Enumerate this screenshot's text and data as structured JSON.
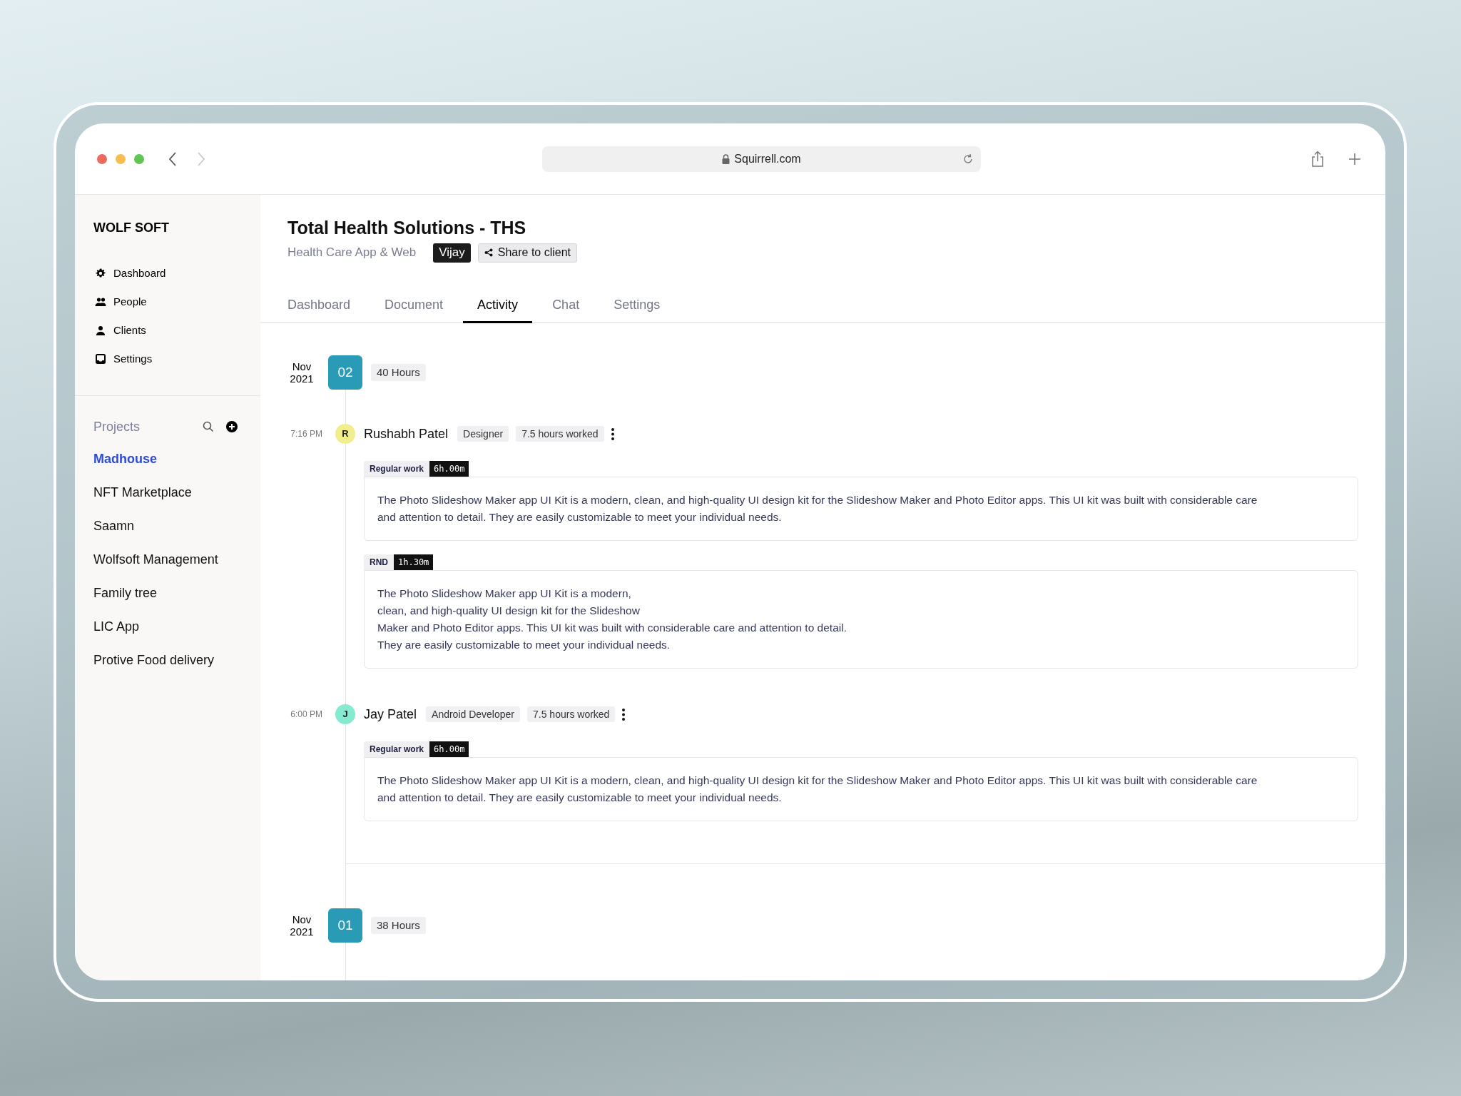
{
  "browser": {
    "url": "Squirrell.com"
  },
  "sidebar": {
    "brand": "WOLF SOFT",
    "nav": [
      {
        "kind": "gear",
        "label": "Dashboard"
      },
      {
        "kind": "people",
        "label": "People"
      },
      {
        "kind": "person",
        "label": "Clients"
      },
      {
        "kind": "tray",
        "label": "Settings"
      }
    ],
    "projects_title": "Projects",
    "projects": [
      {
        "label": "Madhouse",
        "selected": true
      },
      {
        "label": "NFT Marketplace",
        "selected": false
      },
      {
        "label": "Saamn",
        "selected": false
      },
      {
        "label": "Wolfsoft Management",
        "selected": false
      },
      {
        "label": "Family tree",
        "selected": false
      },
      {
        "label": "LIC App",
        "selected": false
      },
      {
        "label": "Protive Food delivery",
        "selected": false
      }
    ]
  },
  "header": {
    "title": "Total Health Solutions - THS",
    "subtitle": "Health Care App & Web",
    "owner": "Vijay",
    "share": "Share to client"
  },
  "tabs": [
    {
      "label": "Dashboard",
      "selected": false
    },
    {
      "label": "Document",
      "selected": false
    },
    {
      "label": "Activity",
      "selected": true
    },
    {
      "label": "Chat",
      "selected": false
    },
    {
      "label": "Settings",
      "selected": false
    }
  ],
  "days": [
    {
      "month": "Nov",
      "year": "2021",
      "day": "02",
      "hours": "40 Hours",
      "entries": [
        {
          "time": "7:16 PM",
          "initial": "R",
          "color": "#f2ee8e",
          "name": "Rushabh Patel",
          "role": "Designer",
          "worked": "7.5 hours worked",
          "tasks": [
            {
              "label": "Regular work",
              "duration": "6h.00m",
              "lines": [
                "The Photo Slideshow Maker app UI Kit is a modern, clean, and high-quality UI design kit for the Slideshow Maker and Photo Editor apps. This UI kit was built with considerable care",
                "and attention to detail. They are easily customizable to meet your individual needs."
              ]
            },
            {
              "label": "RND",
              "duration": "1h.30m",
              "lines": [
                "The Photo Slideshow Maker app UI Kit is a modern,",
                "clean, and high-quality UI design kit for the Slideshow",
                "Maker and Photo Editor apps. This UI kit was built with considerable care and attention to detail.",
                "They are easily customizable to meet your individual needs."
              ]
            }
          ]
        },
        {
          "time": "6:00 PM",
          "initial": "J",
          "color": "#86ead0",
          "name": "Jay Patel",
          "role": "Android Developer",
          "worked": "7.5 hours worked",
          "tasks": [
            {
              "label": "Regular work",
              "duration": "6h.00m",
              "lines": [
                "The Photo Slideshow Maker app UI Kit is a modern, clean, and high-quality UI design kit for the Slideshow Maker and Photo Editor apps. This UI kit was built with considerable care",
                "and attention to detail. They are easily customizable to meet your individual needs."
              ]
            }
          ]
        }
      ]
    },
    {
      "month": "Nov",
      "year": "2021",
      "day": "01",
      "hours": "38 Hours"
    }
  ]
}
